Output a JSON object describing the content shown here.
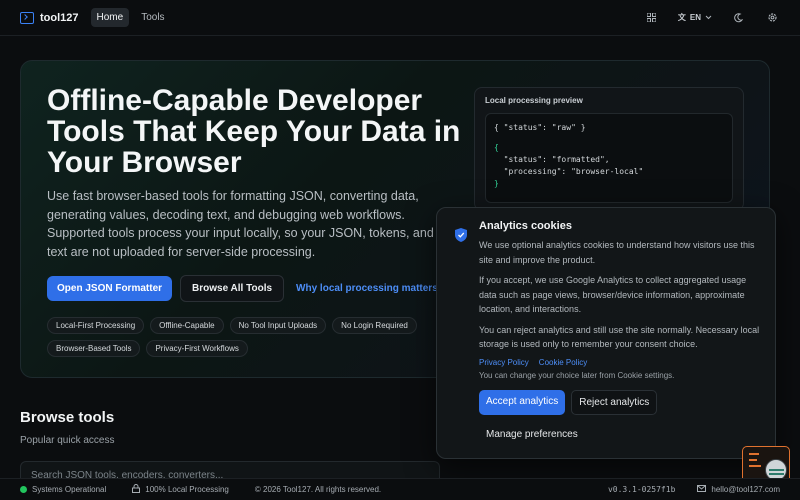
{
  "header": {
    "logo_text": "tool127",
    "nav": [
      {
        "label": "Home"
      },
      {
        "label": "Tools"
      }
    ],
    "language": "EN"
  },
  "hero": {
    "title": "Offline-Capable Developer Tools That Keep Your Data in Your Browser",
    "description": "Use fast browser-based tools for formatting JSON, converting data, generating values, decoding text, and debugging web workflows. Supported tools process your input locally, so your JSON, tokens, and text are not uploaded for server-side processing.",
    "primary_button": "Open JSON Formatter",
    "secondary_button": "Browse All Tools",
    "link": "Why local processing matters",
    "tags": [
      "Local-First Processing",
      "Offline-Capable",
      "No Tool Input Uploads",
      "No Login Required",
      "Browser-Based Tools",
      "Privacy-First Workflows"
    ],
    "preview": {
      "title": "Local processing preview",
      "input_line": "{ \"status\": \"raw\" }",
      "output_lines": [
        "{",
        "  \"status\": \"formatted\",",
        "  \"processing\": \"browser-local\"",
        "}"
      ]
    }
  },
  "browse": {
    "title": "Browse tools",
    "subtitle": "Popular quick access",
    "search_placeholder": "Search JSON tools, encoders, converters..."
  },
  "cookie": {
    "title": "Analytics cookies",
    "p1": "We use optional analytics cookies to understand how visitors use this site and improve the product.",
    "p2": "If you accept, we use Google Analytics to collect aggregated usage data such as page views, browser/device information, approximate location, and interactions.",
    "p3": "You can reject analytics and still use the site normally. Necessary local storage is used only to remember your consent choice.",
    "privacy_link": "Privacy Policy",
    "cookie_link": "Cookie Policy",
    "note": "You can change your choice later from Cookie settings.",
    "accept": "Accept analytics",
    "reject": "Reject analytics",
    "manage": "Manage preferences"
  },
  "footer": {
    "status": "Systems Operational",
    "local": "100% Local Processing",
    "copyright": "© 2026 Tool127. All rights reserved.",
    "version": "v0.3.1-0257f1b",
    "email": "hello@tool127.com"
  },
  "colors": {
    "accent": "#2f6fe8",
    "status_ok": "#22c55e",
    "code_brace": "#34d399",
    "fab": "#e0722f"
  }
}
